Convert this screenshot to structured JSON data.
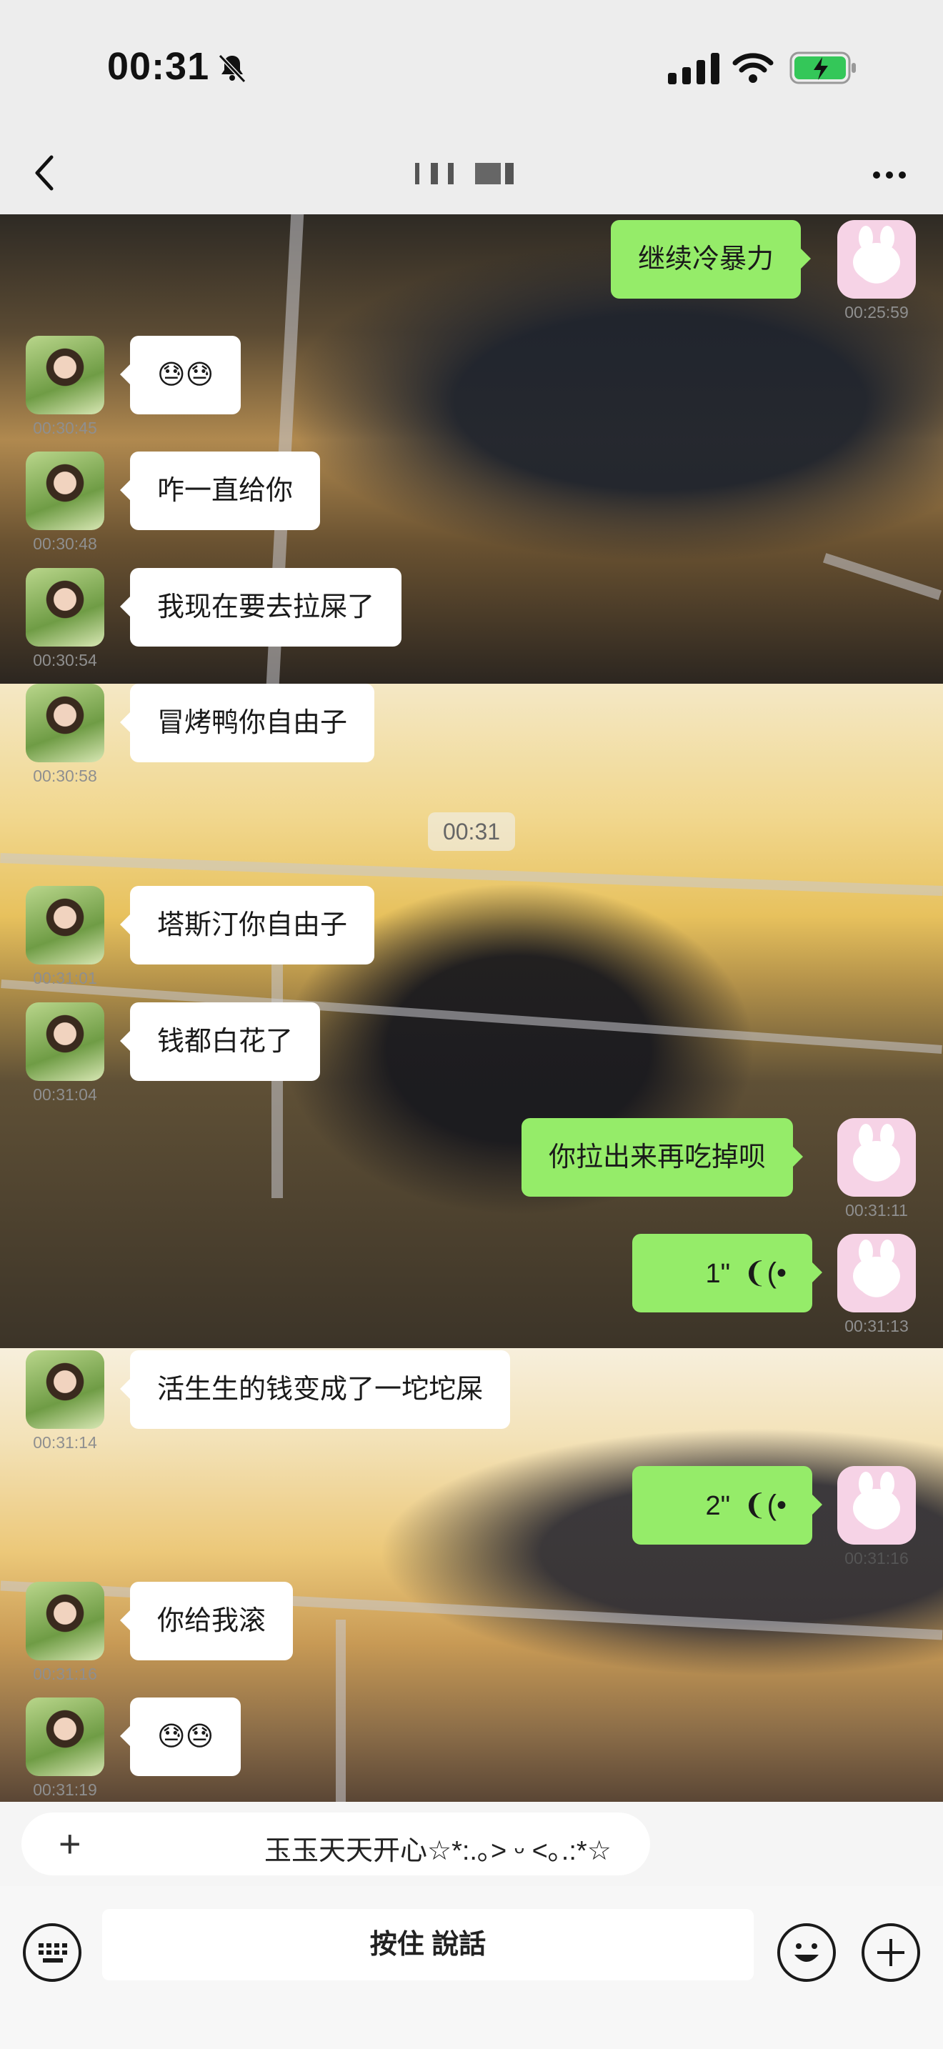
{
  "status_bar": {
    "time": "00:31"
  },
  "chat": {
    "center_time": "00:31",
    "messages": [
      {
        "side": "right",
        "text": "继续冷暴力",
        "time": "00:25:59"
      },
      {
        "side": "left",
        "text": "😓😓",
        "time": "00:30:45"
      },
      {
        "side": "left",
        "text": "咋一直给你",
        "time": "00:30:48"
      },
      {
        "side": "left",
        "text": "我现在要去拉屎了",
        "time": "00:30:54"
      },
      {
        "side": "left",
        "text": "冒烤鸭你自由子",
        "time": "00:30:58"
      },
      {
        "side": "left",
        "text": "塔斯汀你自由子",
        "time": "00:31:01"
      },
      {
        "side": "left",
        "text": "钱都白花了",
        "time": "00:31:04"
      },
      {
        "side": "right",
        "text": "你拉出来再吃掉呗",
        "time": "00:31:11"
      },
      {
        "side": "right",
        "type": "voice",
        "text": "1\"",
        "time": "00:31:13"
      },
      {
        "side": "left",
        "text": "活生生的钱变成了一坨坨屎",
        "time": "00:31:14"
      },
      {
        "side": "right",
        "type": "voice",
        "text": "2\"",
        "time": "00:31:16"
      },
      {
        "side": "left",
        "text": "你给我滚",
        "time": "00:31:16"
      },
      {
        "side": "left",
        "text": "😓😓",
        "time": "00:31:19"
      }
    ]
  },
  "quick_reply": {
    "text": "玉玉天天开心☆*:.｡˃ ᵕ ˂｡.:*☆"
  },
  "input_bar": {
    "hold_to_talk": "按住 說話"
  },
  "icons": [
    "back-icon",
    "more-icon",
    "keyboard-icon",
    "emoji-icon",
    "plus-icon",
    "bell-slash-icon",
    "voice-wave-icon"
  ]
}
